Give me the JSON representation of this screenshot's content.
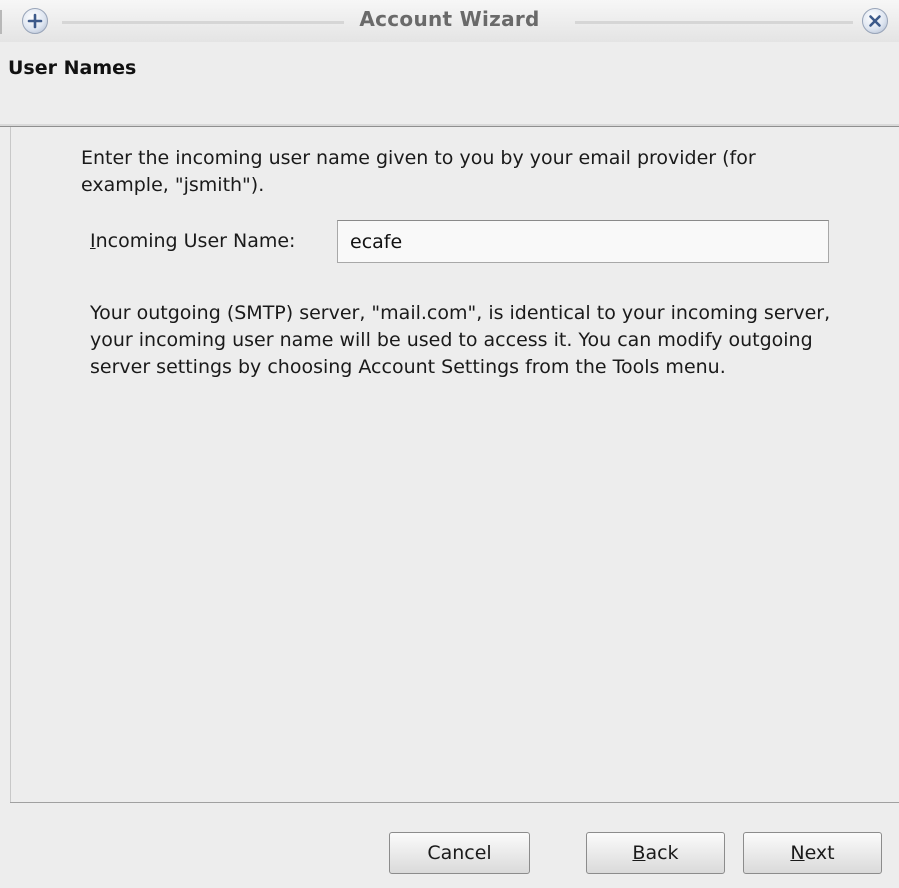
{
  "window": {
    "title": "Account Wizard"
  },
  "titlebar": {
    "left_icon": "add-icon",
    "right_icon": "close-icon"
  },
  "page": {
    "heading": "User Names",
    "intro_text": "Enter the incoming user name given to you by your email provider (for example, \"jsmith\").",
    "incoming_label_mnemonic": "I",
    "incoming_label_rest": "ncoming User Name:",
    "incoming_value": "ecafe",
    "outgoing_text": "Your outgoing (SMTP) server, \"mail.com\", is identical to your incoming server, your incoming user name will be used to access it. You can modify outgoing server settings by choosing Account Settings from the Tools menu."
  },
  "buttons": {
    "cancel": "Cancel",
    "back_mnemonic": "B",
    "back_rest": "ack",
    "next_mnemonic": "N",
    "next_rest": "ext"
  },
  "colors": {
    "window_bg": "#ededed",
    "title_text": "#6a6a6a"
  }
}
